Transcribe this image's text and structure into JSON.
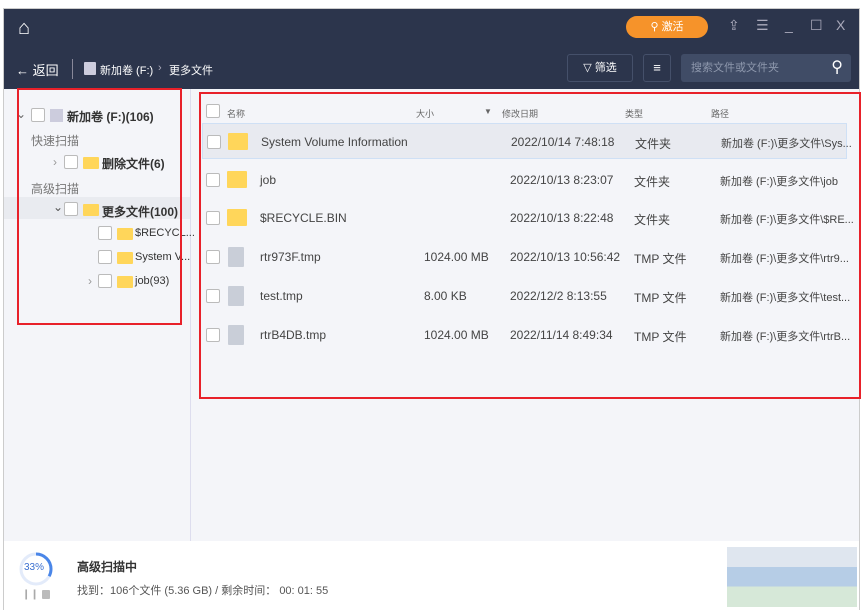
{
  "topbar": {
    "activate_label": "激活",
    "icons": [
      "home-icon",
      "share-icon",
      "menu-icon",
      "minimize-icon",
      "maximize-icon",
      "close-icon"
    ]
  },
  "nav": {
    "back_label": "返回",
    "breadcrumb": [
      "新加卷 (F:)",
      "更多文件"
    ],
    "filter_label": "筛选",
    "search_placeholder": "搜索文件或文件夹"
  },
  "sidebar": {
    "root": "新加卷 (F:)(106)",
    "quick_scan": "快速扫描",
    "deleted": "删除文件(6)",
    "advanced_scan": "高级扫描",
    "more": "更多文件(100)",
    "children": [
      "$RECYCL...",
      "System V...",
      "job(93)"
    ]
  },
  "table": {
    "columns": [
      "名称",
      "大小",
      "修改日期",
      "类型",
      "路径"
    ],
    "rows": [
      {
        "name": "System Volume Information",
        "size": "",
        "date": "2022/10/14 7:48:18",
        "type": "文件夹",
        "path": "新加卷 (F:)\\更多文件\\Sys...",
        "icon": "folder"
      },
      {
        "name": "job",
        "size": "",
        "date": "2022/10/13 8:23:07",
        "type": "文件夹",
        "path": "新加卷 (F:)\\更多文件\\job",
        "icon": "folder"
      },
      {
        "name": "$RECYCLE.BIN",
        "size": "",
        "date": "2022/10/13 8:22:48",
        "type": "文件夹",
        "path": "新加卷 (F:)\\更多文件\\$RE...",
        "icon": "folder"
      },
      {
        "name": "rtr973F.tmp",
        "size": "1024.00 MB",
        "date": "2022/10/13 10:56:42",
        "type": "TMP 文件",
        "path": "新加卷 (F:)\\更多文件\\rtr9...",
        "icon": "file"
      },
      {
        "name": "test.tmp",
        "size": "8.00 KB",
        "date": "2022/12/2 8:13:55",
        "type": "TMP 文件",
        "path": "新加卷 (F:)\\更多文件\\test...",
        "icon": "file"
      },
      {
        "name": "rtrB4DB.tmp",
        "size": "1024.00 MB",
        "date": "2022/11/14 8:49:34",
        "type": "TMP 文件",
        "path": "新加卷 (F:)\\更多文件\\rtrB...",
        "icon": "file"
      }
    ]
  },
  "status": {
    "progress_label": "33%",
    "progress": 33,
    "title": "高级扫描中",
    "detail": "找到：106个文件 (5.36 GB) / 剩余时间： 00: 01: 55"
  },
  "colors": {
    "header": "#2c354c",
    "accent": "#f6932a",
    "annotation": "#e8212a",
    "folder": "#ffd65a"
  }
}
